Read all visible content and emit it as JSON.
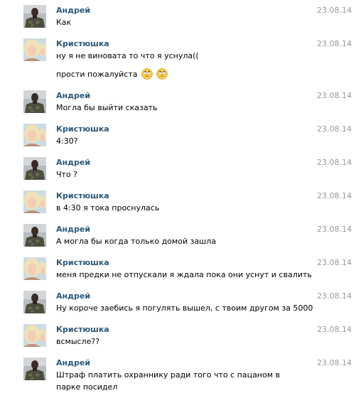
{
  "messages": [
    {
      "author": "Андрей",
      "date": "23.08.14",
      "lines": [
        "Как"
      ]
    },
    {
      "author": "Кристюшка",
      "date": "23.08.14",
      "lines": [
        "ну я не виновата то что я уснула((",
        "прости пожалуйста"
      ],
      "emoji": [
        "eye-roll-emoji",
        "eye-roll-emoji"
      ]
    },
    {
      "author": "Андрей",
      "date": "23.08.14",
      "lines": [
        "Могла бы выйти сказать"
      ]
    },
    {
      "author": "Кристюшка",
      "date": "23.08.14",
      "lines": [
        "4:30?"
      ]
    },
    {
      "author": "Андрей",
      "date": "23.08.14",
      "lines": [
        "Что ?"
      ]
    },
    {
      "author": "Кристюшка",
      "date": "23.08.14",
      "lines": [
        "в 4:30 я тока проснулась"
      ]
    },
    {
      "author": "Андрей",
      "date": "23.08.14",
      "lines": [
        "А могла бы когда только домой зашла"
      ]
    },
    {
      "author": "Кристюшка",
      "date": "23.08.14",
      "lines": [
        "меня предки не отпускали я ждала пока они уснут и свалить"
      ]
    },
    {
      "author": "Андрей",
      "date": "23.08.14",
      "lines": [
        "Ну короче заебись я погулять вышел, с твоим другом за 5000"
      ]
    },
    {
      "author": "Кристюшка",
      "date": "23.08.14",
      "lines": [
        "всмысле??"
      ]
    },
    {
      "author": "Андрей",
      "date": "23.08.14",
      "lines": [
        "Штраф платить охраннику ради того что с пацаном в парке посидел"
      ]
    }
  ],
  "colors": {
    "author": "#2b587a",
    "date": "#999999",
    "text": "#000000",
    "background": "#ffffff"
  }
}
